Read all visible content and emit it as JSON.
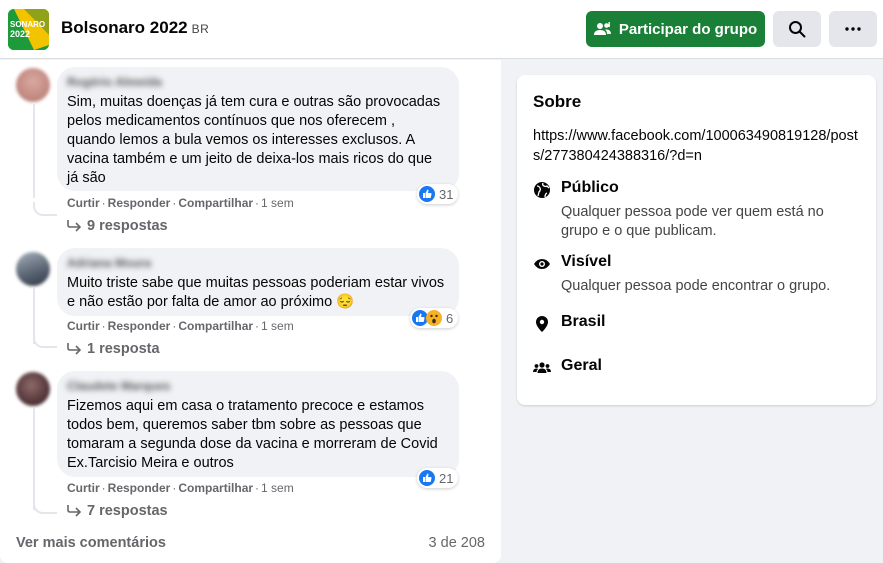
{
  "header": {
    "logo_text_line1": "SONARO",
    "logo_text_line2": "2022",
    "title": "Bolsonaro 2022",
    "flag": "BR",
    "join_label": "Participar do grupo",
    "icons": {
      "join": "group-add-icon",
      "search": "search-icon",
      "more": "more-dots-icon"
    },
    "colors": {
      "join_bg": "#1a7f37",
      "logo_bg": "#1d9a3a"
    }
  },
  "comments": [
    {
      "author": "Rogério Almeida",
      "text": "Sim, muitas doenças já tem cura e outras são provocadas pelos medicamentos contínuos que nos oferecem , quando lemos a bula vemos os interesses exclusos. A vacina também e um jeito de deixa-los mais ricos do que já são",
      "reaction_count": "31",
      "reaction_icons": [
        "like-icon"
      ],
      "like_label": "Curtir",
      "reply_label": "Responder",
      "share_label": "Compartilhar",
      "time": "1 sem",
      "replies": "9 respostas"
    },
    {
      "author": "Adriana Moura",
      "text": "Muito triste sabe que muitas pessoas poderiam estar vivos e não estão por falta de amor ao próximo 😔",
      "reaction_count": "6",
      "reaction_icons": [
        "like-icon",
        "wow-icon"
      ],
      "like_label": "Curtir",
      "reply_label": "Responder",
      "share_label": "Compartilhar",
      "time": "1 sem",
      "replies": "1 resposta"
    },
    {
      "author": "Claudete Marques",
      "text": "Fizemos aqui em casa o tratamento precoce e estamos todos bem, queremos saber tbm sobre as pessoas que tomaram a segunda dose da vacina e morreram de Covid Ex.Tarcisio Meira e outros",
      "reaction_count": "21",
      "reaction_icons": [
        "like-icon"
      ],
      "like_label": "Curtir",
      "reply_label": "Responder",
      "share_label": "Compartilhar",
      "time": "1 sem",
      "replies": "7 respostas"
    }
  ],
  "footer": {
    "more_comments": "Ver mais comentários",
    "count": "3 de 208"
  },
  "about": {
    "title": "Sobre",
    "link": "https://www.facebook.com/100063490819128/posts/277380424388316/?d=n",
    "items": [
      {
        "icon": "globe-icon",
        "label": "Público",
        "desc": "Qualquer pessoa pode ver quem está no grupo e o que publicam."
      },
      {
        "icon": "eye-icon",
        "label": "Visível",
        "desc": "Qualquer pessoa pode encontrar o grupo."
      },
      {
        "icon": "location-pin-icon",
        "label": "Brasil",
        "desc": ""
      },
      {
        "icon": "people-icon",
        "label": "Geral",
        "desc": ""
      }
    ]
  }
}
